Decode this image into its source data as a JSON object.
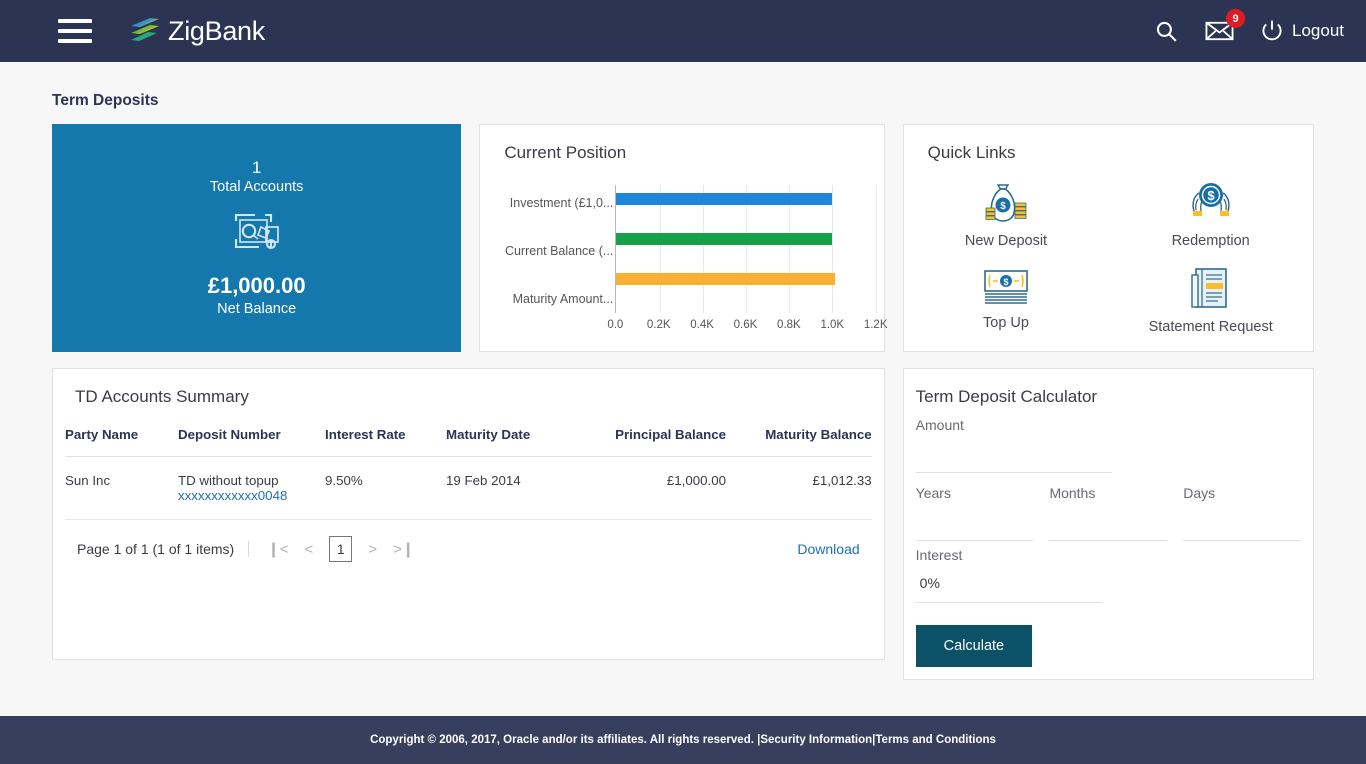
{
  "header": {
    "brand_name": "ZigBank",
    "menu_icon": "hamburger-menu-icon",
    "search_icon": "search-icon",
    "mail_icon": "mail-icon",
    "mail_badge": "9",
    "power_icon": "power-icon",
    "logout_label": "Logout"
  },
  "page": {
    "title": "Term Deposits"
  },
  "total_accounts_tile": {
    "count": "1",
    "count_label": "Total Accounts",
    "icon": "term-deposit-icon",
    "net_balance": "£1,000.00",
    "net_balance_label": "Net Balance",
    "background_color": "#1478ad"
  },
  "current_position": {
    "title": "Current Position"
  },
  "chart_data": {
    "type": "bar",
    "orientation": "horizontal",
    "title": "Current Position",
    "categories": [
      "Investment (£1,0...",
      "Current Balance (...",
      "Maturity Amount..."
    ],
    "values": [
      1000.0,
      1000.0,
      1012.33
    ],
    "colors": [
      "#1f86d8",
      "#15a04a",
      "#fbb034"
    ],
    "xlabel": "",
    "ylabel": "",
    "xlim": [
      0,
      1200
    ],
    "xticks": [
      0,
      200,
      400,
      600,
      800,
      1000,
      1200
    ],
    "xtick_labels": [
      "0.0",
      "0.2K",
      "0.4K",
      "0.6K",
      "0.8K",
      "1.0K",
      "1.2K"
    ],
    "grid": true,
    "legend": false
  },
  "quick_links": {
    "title": "Quick Links",
    "items": [
      {
        "label": "New Deposit",
        "icon": "money-bag-icon"
      },
      {
        "label": "Redemption",
        "icon": "hands-holding-coin-icon"
      },
      {
        "label": "Top Up",
        "icon": "banknote-icon"
      },
      {
        "label": "Statement Request",
        "icon": "statement-document-icon"
      }
    ]
  },
  "td_accounts_summary": {
    "title": "TD Accounts Summary",
    "columns": [
      "Party Name",
      "Deposit Number",
      "Interest Rate",
      "Maturity Date",
      "Principal Balance",
      "Maturity Balance"
    ],
    "rows": [
      {
        "party_name": "Sun Inc",
        "deposit_name": "TD without topup",
        "deposit_number": "xxxxxxxxxxxx0048",
        "interest_rate": "9.50%",
        "maturity_date": "19 Feb 2014",
        "principal_balance": "£1,000.00",
        "maturity_balance": "£1,012.33"
      }
    ],
    "pagination": {
      "page_text": "Page  1  of 1   (1 of 1 items)",
      "first_icon": "first-page-icon",
      "prev_icon": "previous-page-icon",
      "current_page": "1",
      "next_icon": "next-page-icon",
      "last_icon": "last-page-icon",
      "download_label": "Download"
    }
  },
  "term_deposit_calculator": {
    "title": "Term Deposit Calculator",
    "amount_label": "Amount",
    "amount_value": "",
    "years_label": "Years",
    "years_value": "",
    "months_label": "Months",
    "months_value": "",
    "days_label": "Days",
    "days_value": "",
    "interest_label": "Interest",
    "interest_value": "0%",
    "calculate_label": "Calculate",
    "button_color": "#0b5269"
  },
  "footer": {
    "copyright": "Copyright © 2006, 2017, Oracle and/or its affiliates. All rights reserved. | ",
    "security_link": "Security Information",
    "separator": " | ",
    "terms_link": "Terms and Conditions"
  }
}
